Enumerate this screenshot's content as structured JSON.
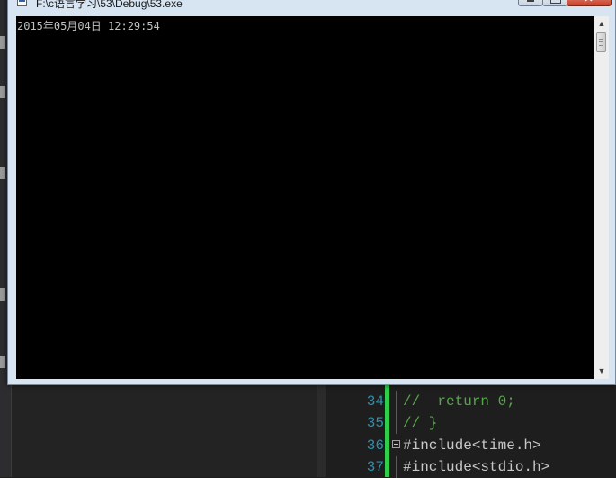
{
  "console": {
    "title": "F:\\c语言学习\\53\\Debug\\53.exe",
    "output": "2015年05月04日 12:29:54",
    "close_label": "✕"
  },
  "editor": {
    "lines": [
      {
        "number": "34",
        "text": "//  return 0;"
      },
      {
        "number": "35",
        "text": "// }"
      },
      {
        "number": "36",
        "text": "#include<time.h>"
      },
      {
        "number": "37",
        "text": "#include<stdio.h>"
      }
    ]
  },
  "colors": {
    "console_bg": "#000000",
    "console_text": "#c0c0c0",
    "line_number": "#2b91af",
    "comment": "#57a64a",
    "change_bar": "#2fcf4a"
  }
}
